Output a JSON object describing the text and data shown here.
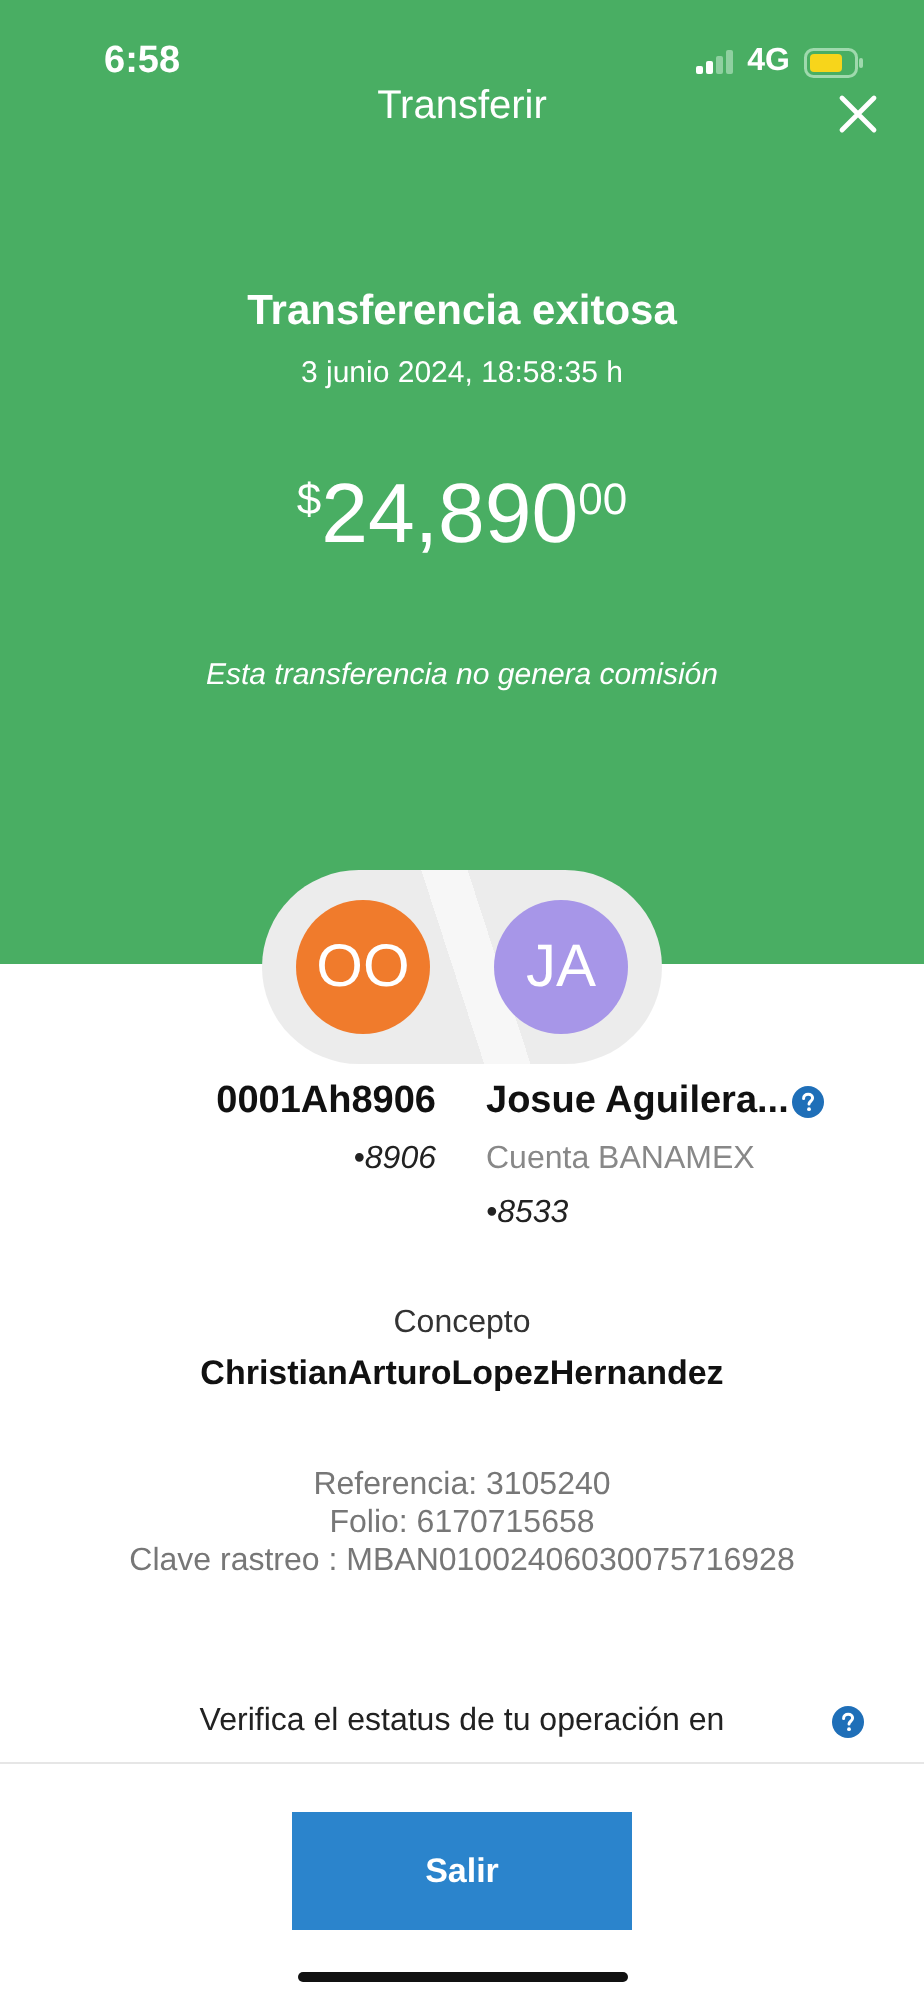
{
  "status_bar": {
    "time": "6:58",
    "network": "4G"
  },
  "header": {
    "title": "Transferir"
  },
  "result": {
    "heading": "Transferencia exitosa",
    "date": "3 junio 2024, 18:58:35 h",
    "amount": {
      "currency": "$",
      "integer": "24,890",
      "cents": "00"
    },
    "note": "Esta transferencia no genera comisión"
  },
  "parties": [
    {
      "initials": "OO",
      "color": "#f07b2c",
      "name": "0001Ah8906",
      "account": "•8906"
    },
    {
      "initials": "JA",
      "color": "#a796e8",
      "name": "Josue Aguilera...",
      "bank": "Cuenta BANAMEX",
      "account": "•8533",
      "help": true
    }
  ],
  "concept": {
    "label": "Concepto",
    "value": "ChristianArturoLopezHernandez"
  },
  "details": [
    "Referencia: 3105240",
    "Folio: 6170715658",
    "Clave rastreo : MBAN01002406030075716928"
  ],
  "verify": {
    "text": "Verifica el estatus de tu operación en"
  },
  "buttons": [
    {
      "label": "Salir"
    }
  ]
}
